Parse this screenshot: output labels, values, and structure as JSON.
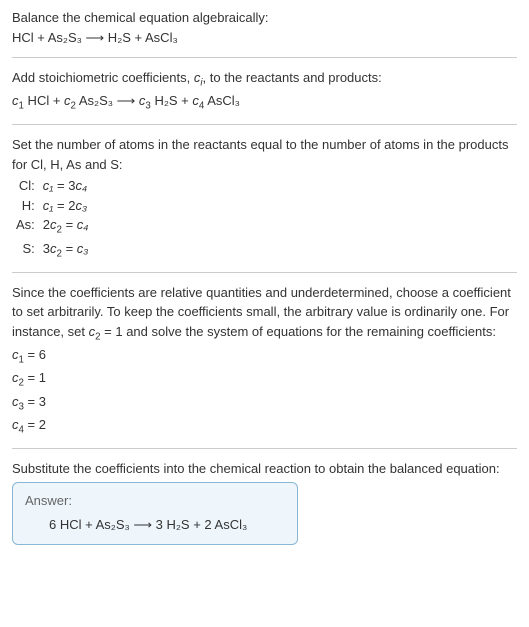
{
  "intro": {
    "line1": "Balance the chemical equation algebraically:",
    "eq": "HCl + As₂S₃ ⟶ H₂S + AsCl₃"
  },
  "add_coeffs": {
    "text_before": "Add stoichiometric coefficients, ",
    "ci": "c",
    "ci_sub": "i",
    "text_after": ", to the reactants and products:",
    "eq_parts": {
      "c1": "c",
      "c1s": "1",
      "r1": " HCl + ",
      "c2": "c",
      "c2s": "2",
      "r2": " As₂S₃ ⟶ ",
      "c3": "c",
      "c3s": "3",
      "r3": " H₂S + ",
      "c4": "c",
      "c4s": "4",
      "r4": " AsCl₃"
    }
  },
  "atoms": {
    "intro": "Set the number of atoms in the reactants equal to the number of atoms in the products for Cl, H, As and S:",
    "rows": [
      {
        "label": "Cl:",
        "lhs": "c₁",
        "eq": " = 3",
        "rhs": "c₄"
      },
      {
        "label": "H:",
        "lhs": "c₁",
        "eq": " = 2",
        "rhs": "c₃"
      },
      {
        "label": "As:",
        "lhs": "2c₂",
        "eq": " = ",
        "rhs": "c₄"
      },
      {
        "label": "S:",
        "lhs": "3c₂",
        "eq": " = ",
        "rhs": "c₃"
      }
    ]
  },
  "solve": {
    "intro_a": "Since the coefficients are relative quantities and underdetermined, choose a coefficient to set arbitrarily. To keep the coefficients small, the arbitrary value is ordinarily one. For instance, set ",
    "set_c": "c",
    "set_cs": "2",
    "set_val": " = 1",
    "intro_b": " and solve the system of equations for the remaining coefficients:",
    "results": [
      {
        "c": "c",
        "s": "1",
        "v": " = 6"
      },
      {
        "c": "c",
        "s": "2",
        "v": " = 1"
      },
      {
        "c": "c",
        "s": "3",
        "v": " = 3"
      },
      {
        "c": "c",
        "s": "4",
        "v": " = 2"
      }
    ]
  },
  "sub": {
    "text": "Substitute the coefficients into the chemical reaction to obtain the balanced equation:"
  },
  "answer": {
    "title": "Answer:",
    "eq": "6 HCl + As₂S₃ ⟶ 3 H₂S + 2 AsCl₃"
  },
  "chart_data": {
    "type": "table",
    "title": "Balancing chemical equation algebraically",
    "unbalanced_equation": "HCl + As2S3 -> H2S + AsCl3",
    "atom_balance_equations": {
      "Cl": "c1 = 3*c4",
      "H": "c1 = 2*c3",
      "As": "2*c2 = c4",
      "S": "3*c2 = c3"
    },
    "fixed_coefficient": {
      "c2": 1
    },
    "solution": {
      "c1": 6,
      "c2": 1,
      "c3": 3,
      "c4": 2
    },
    "balanced_equation": "6 HCl + As2S3 -> 3 H2S + 2 AsCl3"
  }
}
